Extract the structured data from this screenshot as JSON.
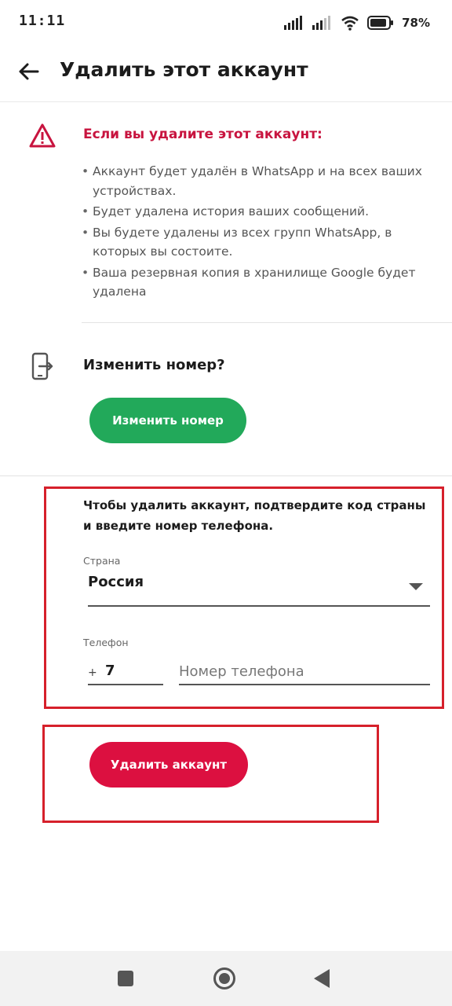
{
  "status_bar": {
    "time": "11:11",
    "battery": "78%"
  },
  "app_bar": {
    "title": "Удалить этот аккаунт"
  },
  "warning": {
    "heading": "Если вы удалите этот аккаунт:",
    "bullets": [
      "Аккаунт будет удалён в WhatsApp и на всех ваших устройствах.",
      "Будет удалена история ваших сообщений.",
      "Вы будете удалены из всех групп WhatsApp, в которых вы состоите.",
      "Ваша резервная копия в хранилище Google будет удалена"
    ]
  },
  "change_number": {
    "heading": "Изменить номер?",
    "button_label": "Изменить номер"
  },
  "form": {
    "instruction": "Чтобы удалить аккаунт, подтвердите код страны и введите номер телефона.",
    "country_label": "Страна",
    "country_value": "Россия",
    "phone_label": "Телефон",
    "plus": "+",
    "country_code": "7",
    "phone_placeholder": "Номер телефона"
  },
  "delete": {
    "button_label": "Удалить аккаунт"
  },
  "colors": {
    "accent_red": "#dc1040",
    "accent_green": "#22a95a",
    "highlight": "#d6202b"
  },
  "icons": [
    "back-arrow-icon",
    "warning-icon",
    "change-phone-icon",
    "dropdown-arrow-icon",
    "signal-icon",
    "wifi-icon",
    "battery-icon"
  ]
}
